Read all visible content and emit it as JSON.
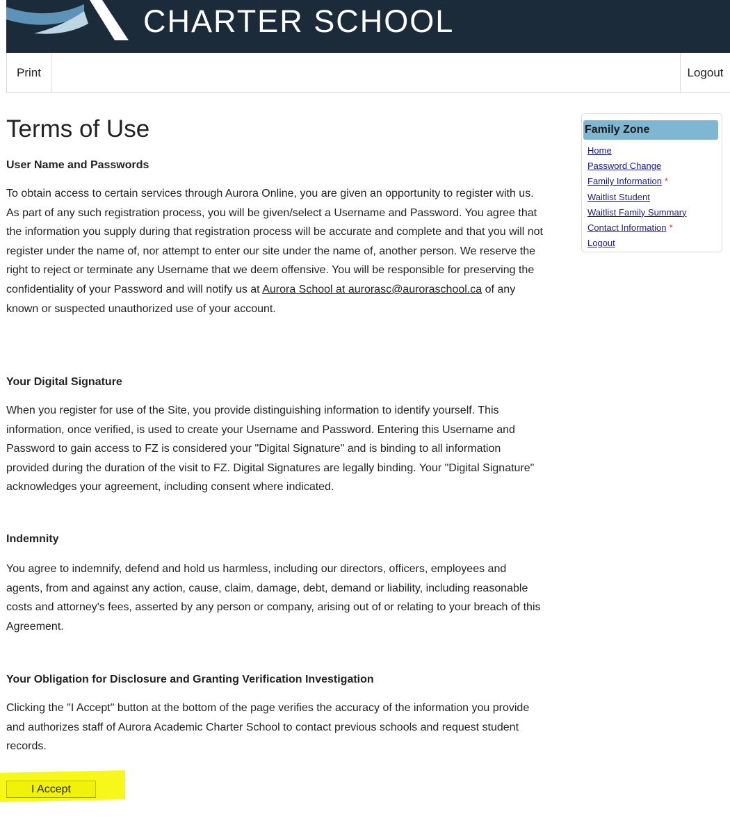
{
  "header": {
    "school_title": "CHARTER SCHOOL"
  },
  "toolbar": {
    "print_label": "Print",
    "logout_label": "Logout"
  },
  "main": {
    "title": "Terms of Use",
    "sections": [
      {
        "heading": "User Name and Passwords",
        "text_before_link": "To obtain access to certain services through Aurora Online, you are given an opportunity to register with us. As part of any such registration process, you will be given/select a Username and Password. You agree that the information you supply during that registration process will be accurate and complete and that you will not register under the name of, nor attempt to enter our site under the name of, another person. We reserve the right to reject or terminate any Username that we deem offensive. You will be responsible for preserving the confidentiality of your Password and will notify us at ",
        "link_text": "Aurora School at aurorasc@auroraschool.ca",
        "text_after_link": " of any known or suspected unauthorized use of your account."
      },
      {
        "heading": "Your Digital Signature",
        "text": "When you register for use of the Site, you provide distinguishing information to identify yourself. This information, once verified, is used to create your Username and Password. Entering this Username and Password to gain access to FZ is considered your \"Digital Signature\" and is binding to all information provided during the duration of the visit to FZ. Digital Signatures are legally binding. Your \"Digital Signature\" acknowledges your agreement, including consent where indicated."
      },
      {
        "heading": "Indemnity",
        "text": "You agree to indemnify, defend and hold us harmless, including our directors, officers, employees and agents, from and against any action, cause, claim, damage, debt, demand or liability, including reasonable costs and attorney's fees, asserted by any person or company, arising out of or relating to your breach of this Agreement."
      },
      {
        "heading": "Your Obligation for Disclosure and Granting Verification Investigation",
        "text": "Clicking the \"I Accept\" button at the bottom of the page verifies the accuracy of the information you provide and authorizes staff of Aurora Academic Charter School to contact previous schools and request student records."
      }
    ],
    "accept_button_label": "I Accept"
  },
  "family_zone": {
    "title": "Family Zone",
    "links": [
      {
        "label": "Home",
        "required": ""
      },
      {
        "label": "Password Change",
        "required": ""
      },
      {
        "label": "Family Information",
        "required": "*"
      },
      {
        "label": "Waitlist Student",
        "required": ""
      },
      {
        "label": "Waitlist Family Summary",
        "required": ""
      },
      {
        "label": "Contact Information",
        "required": "*"
      },
      {
        "label": "Logout",
        "required": ""
      }
    ]
  },
  "colors": {
    "banner_bg": "#1c2b3a",
    "panel_header": "#7fb6d2",
    "highlight": "#f7f71a",
    "required_marker": "#e03030"
  }
}
